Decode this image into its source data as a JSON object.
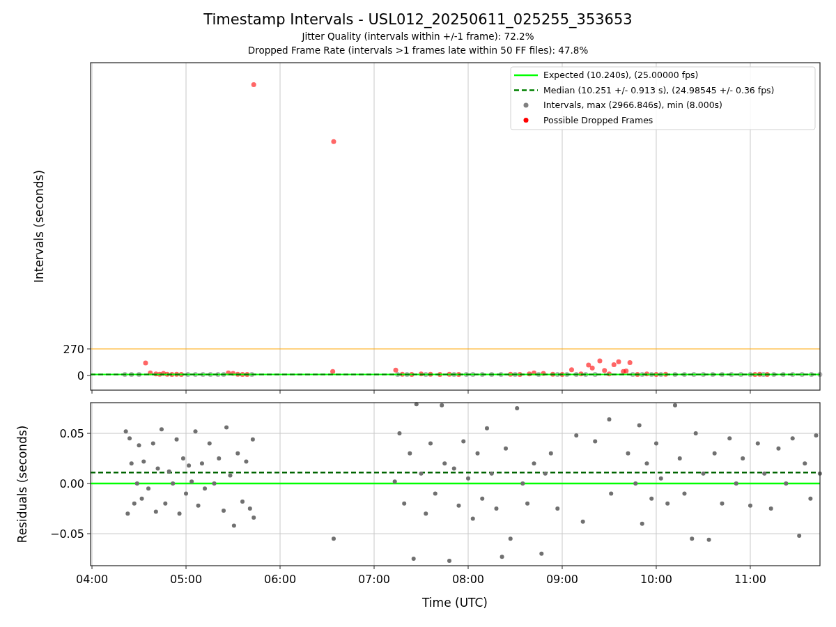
{
  "title": "Timestamp Intervals - USL012_20250611_025255_353653",
  "subtitles": [
    "Jitter Quality (intervals within +/-1 frame): 72.2%",
    "Dropped Frame Rate (intervals >1 frames late within 50 FF files): 47.8%"
  ],
  "intervals_chart": {
    "chart_data": {
      "type": "scatter",
      "ylabel": "Intervals (seconds)",
      "xlim": [
        3.985,
        11.741
      ],
      "ylim": [
        -150,
        3190
      ],
      "yticks": [
        0,
        270
      ],
      "grid": "x",
      "legend": "upper right",
      "ref_lines": [
        {
          "axis": "y",
          "value": 270,
          "color": "#ffa500"
        },
        {
          "axis": "y",
          "value": 10.24,
          "label": "Expected (10.240s), (25.00000 fps)",
          "color": "#00ff00"
        },
        {
          "axis": "y",
          "value": 10.251,
          "label": "Median (10.251 +/- 0.913 s), (24.98545 +/- 0.36 fps)",
          "color": "#008000"
        }
      ],
      "x": [
        4.35,
        4.42,
        4.5,
        4.57,
        4.62,
        4.68,
        4.72,
        4.76,
        4.8,
        4.85,
        4.9,
        4.95,
        5.02,
        5.1,
        5.18,
        5.26,
        5.34,
        5.4,
        5.45,
        5.5,
        5.55,
        5.6,
        5.65,
        5.7,
        5.72,
        6.56,
        6.57,
        7.23,
        7.25,
        7.3,
        7.35,
        7.4,
        7.5,
        7.55,
        7.6,
        7.7,
        7.8,
        7.85,
        7.9,
        7.98,
        8.05,
        8.15,
        8.25,
        8.35,
        8.45,
        8.5,
        8.55,
        8.65,
        8.7,
        8.75,
        8.8,
        8.9,
        8.95,
        9.0,
        9.05,
        9.1,
        9.15,
        9.2,
        9.25,
        9.28,
        9.32,
        9.35,
        9.4,
        9.45,
        9.5,
        9.55,
        9.6,
        9.65,
        9.68,
        9.72,
        9.75,
        9.8,
        9.85,
        9.9,
        9.95,
        10.0,
        10.05,
        10.1,
        10.2,
        10.3,
        10.4,
        10.5,
        10.6,
        10.7,
        10.8,
        10.9,
        11.0,
        11.05,
        11.1,
        11.14,
        11.18,
        11.25,
        11.35,
        11.45,
        11.55,
        11.65,
        11.74
      ],
      "series": [
        {
          "name": "Intervals, max (2966.846s), min (8.000s)",
          "color": "#808080",
          "values": [
            10,
            10,
            10,
            null,
            null,
            null,
            null,
            null,
            null,
            null,
            null,
            null,
            10,
            10,
            10,
            10,
            10,
            10,
            null,
            null,
            null,
            null,
            null,
            10,
            null,
            null,
            null,
            null,
            10,
            null,
            10,
            null,
            null,
            10,
            null,
            null,
            null,
            10,
            null,
            10,
            10,
            10,
            10,
            10,
            null,
            10,
            null,
            null,
            null,
            10,
            null,
            null,
            10,
            null,
            10,
            null,
            10,
            null,
            10,
            null,
            null,
            10,
            null,
            null,
            null,
            null,
            null,
            null,
            null,
            null,
            10,
            null,
            10,
            null,
            10,
            null,
            10,
            null,
            10,
            10,
            10,
            10,
            10,
            10,
            10,
            10,
            10,
            null,
            null,
            10,
            null,
            10,
            10,
            10,
            10,
            10,
            10
          ]
        },
        {
          "name": "Possible Dropped Frames",
          "color": "#ff0000",
          "values": [
            null,
            null,
            null,
            128,
            25,
            15,
            12,
            20,
            12,
            10,
            12,
            10,
            null,
            null,
            null,
            null,
            null,
            null,
            25,
            20,
            12,
            10,
            10,
            null,
            2967,
            40,
            2386,
            55,
            null,
            12,
            null,
            10,
            15,
            null,
            12,
            10,
            12,
            null,
            10,
            null,
            null,
            null,
            null,
            null,
            12,
            null,
            10,
            15,
            25,
            null,
            20,
            12,
            null,
            10,
            null,
            57,
            null,
            15,
            null,
            106,
            75,
            null,
            149,
            50,
            15,
            110,
            140,
            40,
            45,
            130,
            null,
            10,
            null,
            15,
            null,
            10,
            null,
            12,
            null,
            null,
            null,
            null,
            null,
            null,
            null,
            null,
            null,
            10,
            12,
            null,
            10,
            null,
            null,
            null,
            null,
            null,
            null
          ]
        }
      ]
    }
  },
  "residuals_chart": {
    "chart_data": {
      "type": "scatter",
      "xlabel": "Time (UTC)",
      "ylabel": "Residuals (seconds)",
      "xlim": [
        3.985,
        11.741
      ],
      "ylim": [
        -0.0819,
        0.0806
      ],
      "xticks": [
        {
          "value": 4,
          "label": "04:00"
        },
        {
          "value": 5,
          "label": "05:00"
        },
        {
          "value": 6,
          "label": "06:00"
        },
        {
          "value": 7,
          "label": "07:00"
        },
        {
          "value": 8,
          "label": "08:00"
        },
        {
          "value": 9,
          "label": "09:00"
        },
        {
          "value": 10,
          "label": "10:00"
        },
        {
          "value": 11,
          "label": "11:00"
        }
      ],
      "yticks": [
        {
          "value": -0.05,
          "label": "−0.05"
        },
        {
          "value": 0,
          "label": "0.00"
        },
        {
          "value": 0.05,
          "label": "0.05"
        }
      ],
      "grid": "both",
      "ref_lines": [
        {
          "axis": "y",
          "value": 0,
          "color": "#00ff00"
        },
        {
          "axis": "y",
          "value": 0.011,
          "color": "#006400"
        }
      ],
      "x": [
        4.36,
        4.38,
        4.4,
        4.42,
        4.45,
        4.48,
        4.5,
        4.53,
        4.55,
        4.6,
        4.65,
        4.68,
        4.7,
        4.74,
        4.78,
        4.82,
        4.86,
        4.9,
        4.93,
        4.97,
        5.0,
        5.03,
        5.06,
        5.1,
        5.13,
        5.17,
        5.2,
        5.25,
        5.3,
        5.35,
        5.4,
        5.43,
        5.47,
        5.51,
        5.55,
        5.6,
        5.64,
        5.68,
        5.71,
        5.72,
        6.57,
        7.22,
        7.27,
        7.32,
        7.38,
        7.42,
        7.45,
        7.5,
        7.55,
        7.6,
        7.65,
        7.72,
        7.75,
        7.8,
        7.85,
        7.9,
        7.95,
        8.0,
        8.05,
        8.1,
        8.15,
        8.2,
        8.25,
        8.3,
        8.36,
        8.4,
        8.45,
        8.52,
        8.58,
        8.63,
        8.7,
        8.78,
        8.82,
        8.88,
        8.95,
        9.15,
        9.22,
        9.35,
        9.5,
        9.52,
        9.7,
        9.78,
        9.82,
        9.85,
        9.9,
        9.95,
        10.0,
        10.05,
        10.12,
        10.2,
        10.25,
        10.3,
        10.38,
        10.42,
        10.5,
        10.56,
        10.62,
        10.7,
        10.78,
        10.85,
        10.92,
        11.0,
        11.08,
        11.15,
        11.22,
        11.3,
        11.38,
        11.45,
        11.52,
        11.58,
        11.64,
        11.7,
        11.74
      ],
      "series": [
        {
          "color": "#707070",
          "values": [
            0.052,
            -0.03,
            0.045,
            0.02,
            -0.02,
            0.0,
            0.038,
            -0.015,
            0.022,
            -0.005,
            0.04,
            -0.028,
            0.015,
            0.054,
            -0.02,
            0.012,
            0.0,
            0.044,
            -0.03,
            0.025,
            -0.01,
            0.018,
            0.002,
            0.052,
            -0.022,
            0.02,
            -0.005,
            0.04,
            0.0,
            0.025,
            -0.027,
            0.056,
            0.008,
            -0.042,
            0.03,
            -0.018,
            0.022,
            -0.025,
            0.044,
            -0.034,
            -0.055,
            0.002,
            0.05,
            -0.02,
            0.03,
            -0.075,
            0.079,
            0.01,
            -0.03,
            0.04,
            -0.01,
            0.078,
            0.02,
            -0.077,
            0.015,
            -0.022,
            0.042,
            0.005,
            -0.035,
            0.03,
            -0.015,
            0.055,
            0.01,
            -0.025,
            -0.073,
            0.035,
            -0.055,
            0.075,
            0.0,
            -0.02,
            0.02,
            -0.07,
            0.01,
            0.03,
            -0.025,
            0.048,
            -0.038,
            0.042,
            0.064,
            -0.01,
            0.03,
            0.0,
            0.058,
            -0.04,
            0.02,
            -0.015,
            0.04,
            0.005,
            -0.02,
            0.078,
            0.025,
            -0.01,
            -0.055,
            0.05,
            0.01,
            -0.056,
            0.03,
            -0.02,
            0.045,
            0.0,
            0.025,
            -0.022,
            0.04,
            0.01,
            -0.025,
            0.035,
            0.0,
            0.045,
            -0.052,
            0.02,
            -0.015,
            0.048,
            0.01
          ]
        }
      ]
    }
  }
}
